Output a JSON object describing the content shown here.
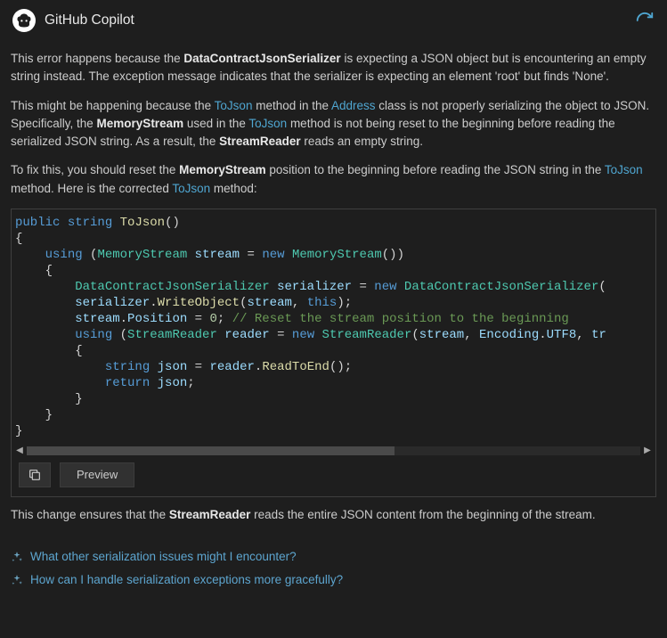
{
  "header": {
    "title": "GitHub Copilot"
  },
  "p1": {
    "a": "This error happens because the ",
    "b": "DataContractJsonSerializer",
    "c": " is expecting a JSON object but is encountering an empty string instead. The exception message indicates that the serializer is expecting an element 'root' but finds 'None'."
  },
  "p2": {
    "a": "This might be happening because the ",
    "b": "ToJson",
    "c": " method in the ",
    "d": "Address",
    "e": " class is not properly serializing the object to JSON. Specifically, the ",
    "f": "MemoryStream",
    "g": " used in the ",
    "h": "ToJson",
    "i": " method is not being reset to the beginning before reading the serialized JSON string. As a result, the ",
    "j": "StreamReader",
    "k": " reads an empty string."
  },
  "p3": {
    "a": "To fix this, you should reset the ",
    "b": "MemoryStream",
    "c": " position to the beginning before reading the JSON string in the ",
    "d": "ToJson",
    "e": " method. Here is the corrected ",
    "f": "ToJson",
    "g": " method:"
  },
  "p4": {
    "a": "This change ensures that the ",
    "b": "StreamReader",
    "c": " reads the entire JSON content from the beginning of the stream."
  },
  "code": {
    "kw_public": "public",
    "kw_string": "string",
    "fn_tojson": "ToJson",
    "kw_using": "using",
    "type_ms": "MemoryStream",
    "var_stream": "stream",
    "kw_new": "new",
    "type_dcjs": "DataContractJsonSerializer",
    "var_serializer": "serializer",
    "fn_writeobj": "WriteObject",
    "kw_this": "this",
    "prop_position": "Position",
    "num_zero": "0",
    "comment": "// Reset the stream position to the beginning",
    "type_sr": "StreamReader",
    "var_reader": "reader",
    "prop_encoding": "Encoding",
    "prop_utf8": "UTF8",
    "var_tr": "tr",
    "var_json": "json",
    "fn_readend": "ReadToEnd",
    "kw_return": "return"
  },
  "toolbar": {
    "preview": "Preview"
  },
  "suggestions": [
    "What other serialization issues might I encounter?",
    "How can I handle serialization exceptions more gracefully?"
  ]
}
